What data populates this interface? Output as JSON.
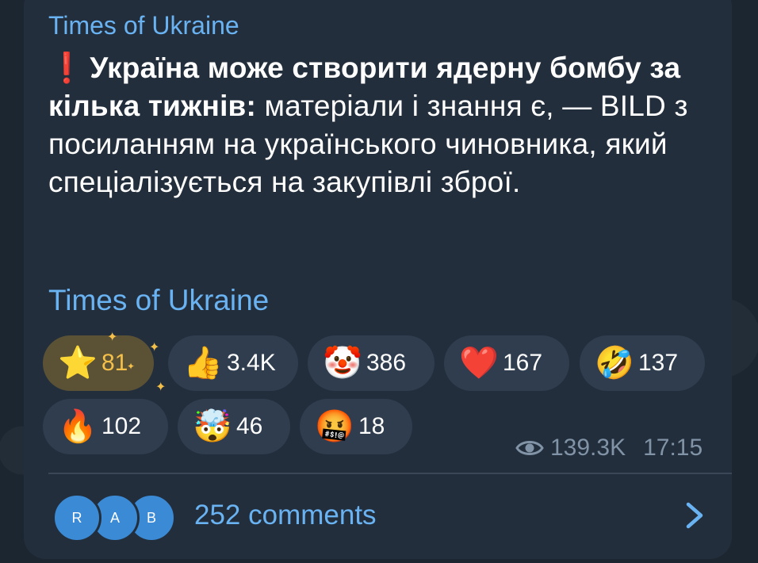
{
  "post": {
    "channel_name": "Times of Ukraine",
    "headline_bold": "Україна може створити ядерну бомбу за кілька тижнів:",
    "body_text": " матеріали і знання є, — BILD з посиланням на українського чиновника, який спеціалізується на закупівлі зброї.",
    "exclaim_icon": "❗",
    "signature": "Times of Ukraine"
  },
  "reactions": [
    {
      "emoji": "⭐",
      "name": "star",
      "count": "81"
    },
    {
      "emoji": "👍",
      "name": "thumbs-up",
      "count": "3.4K"
    },
    {
      "emoji": "🤡",
      "name": "clown",
      "count": "386"
    },
    {
      "emoji": "❤️",
      "name": "heart",
      "count": "167"
    },
    {
      "emoji": "🤣",
      "name": "rofl",
      "count": "137"
    },
    {
      "emoji": "🔥",
      "name": "fire",
      "count": "102"
    },
    {
      "emoji": "🤯",
      "name": "mind-blown",
      "count": "46"
    },
    {
      "emoji": "🤬",
      "name": "cursing",
      "count": "18"
    }
  ],
  "meta": {
    "views": "139.3K",
    "time": "17:15"
  },
  "comments": {
    "avatars": [
      "R",
      "A",
      "B"
    ],
    "label": "252 comments"
  },
  "colors": {
    "accent": "#6ab3f3",
    "bubble": "#232e3c",
    "background": "#1c2631"
  }
}
